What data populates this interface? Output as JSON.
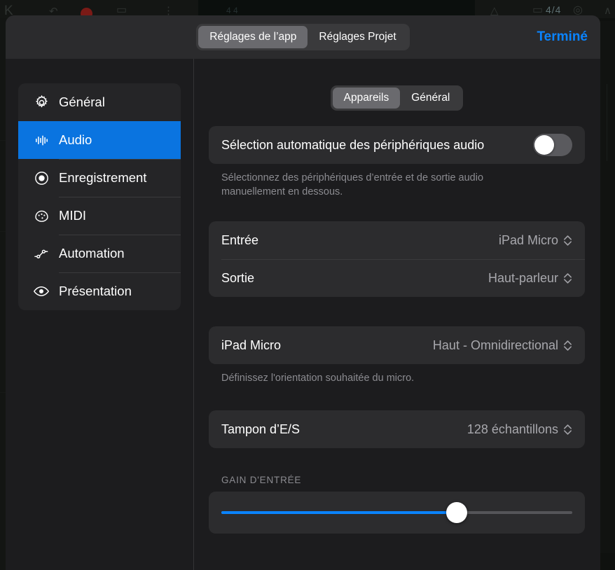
{
  "background_app": {
    "time_signature": "4/4",
    "glyphs": [
      "K",
      "record-dot",
      "metronome",
      "settings"
    ]
  },
  "header": {
    "tabs": [
      {
        "label": "Réglages de l’app",
        "active": true
      },
      {
        "label": "Réglages Projet",
        "active": false
      }
    ],
    "done_label": "Terminé",
    "done_color": "#0a84ff"
  },
  "sidebar": {
    "items": [
      {
        "label": "Général",
        "icon": "gear-icon",
        "selected": false
      },
      {
        "label": "Audio",
        "icon": "waveform-icon",
        "selected": true
      },
      {
        "label": "Enregistrement",
        "icon": "record-circle-icon",
        "selected": false
      },
      {
        "label": "MIDI",
        "icon": "midi-connector-icon",
        "selected": false
      },
      {
        "label": "Automation",
        "icon": "automation-curve-icon",
        "selected": false
      },
      {
        "label": "Présentation",
        "icon": "eye-icon",
        "selected": false
      }
    ],
    "selected_color": "#0a74e0"
  },
  "content": {
    "subtabs": [
      {
        "label": "Appareils",
        "active": true
      },
      {
        "label": "Général",
        "active": false
      }
    ],
    "auto_select": {
      "label": "Sélection automatique des périphériques audio",
      "toggle_state": "off",
      "footnote": "Sélectionnez des périphériques d’entrée et de sortie audio manuellement en dessous."
    },
    "devices": {
      "rows": [
        {
          "label": "Entrée",
          "value": "iPad Micro",
          "control": "chevron-updown-icon"
        },
        {
          "label": "Sortie",
          "value": "Haut-parleur",
          "control": "chevron-updown-icon"
        }
      ]
    },
    "mic_orientation": {
      "rows": [
        {
          "label": "iPad Micro",
          "value": "Haut - Omnidirectional",
          "control": "chevron-updown-icon"
        }
      ],
      "footnote": "Définissez l'orientation souhaitée du micro."
    },
    "io_buffer": {
      "rows": [
        {
          "label": "Tampon d’E/S",
          "value": "128 échantillons",
          "control": "chevron-updown-icon"
        }
      ]
    },
    "input_gain": {
      "title": "GAIN D'ENTRÉE",
      "value_percent": 67,
      "fill_color": "#0a84ff"
    }
  }
}
